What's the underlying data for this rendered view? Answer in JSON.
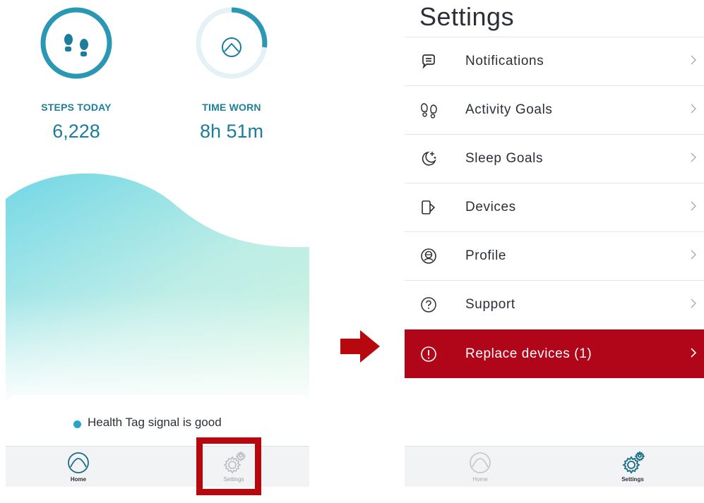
{
  "left_screen": {
    "stats": [
      {
        "label": "STEPS TODAY",
        "value": "6,228",
        "icon": "footsteps-icon"
      },
      {
        "label": "TIME WORN",
        "value": "8h 51m",
        "icon": "wear-mountain-icon",
        "progress": 0.37
      }
    ],
    "status": {
      "text": "Health Tag signal is good",
      "dot_color": "#2aa3c6"
    },
    "tabs": [
      {
        "label": "Home",
        "icon": "home-wave-icon",
        "active": true
      },
      {
        "label": "Settings",
        "icon": "settings-gear-icon",
        "active": false
      }
    ]
  },
  "right_screen": {
    "title": "Settings",
    "menu": [
      {
        "label": "Notifications",
        "icon": "chat-bubble-icon"
      },
      {
        "label": "Activity Goals",
        "icon": "footsteps-outline-icon"
      },
      {
        "label": "Sleep Goals",
        "icon": "moon-stars-icon"
      },
      {
        "label": "Devices",
        "icon": "device-icon"
      },
      {
        "label": "Profile",
        "icon": "profile-icon"
      },
      {
        "label": "Support",
        "icon": "question-icon"
      },
      {
        "label": "Replace devices (1)",
        "icon": "alert-icon",
        "alert": true
      }
    ],
    "tabs": [
      {
        "label": "Home",
        "icon": "home-wave-icon",
        "active": false
      },
      {
        "label": "Settings",
        "icon": "settings-gear-icon",
        "active": true
      }
    ]
  },
  "colors": {
    "brand_teal": "#1b7d99",
    "ring_teal": "#2a98b5",
    "alert_red": "#b10519",
    "highlight_red": "#b8080f"
  }
}
